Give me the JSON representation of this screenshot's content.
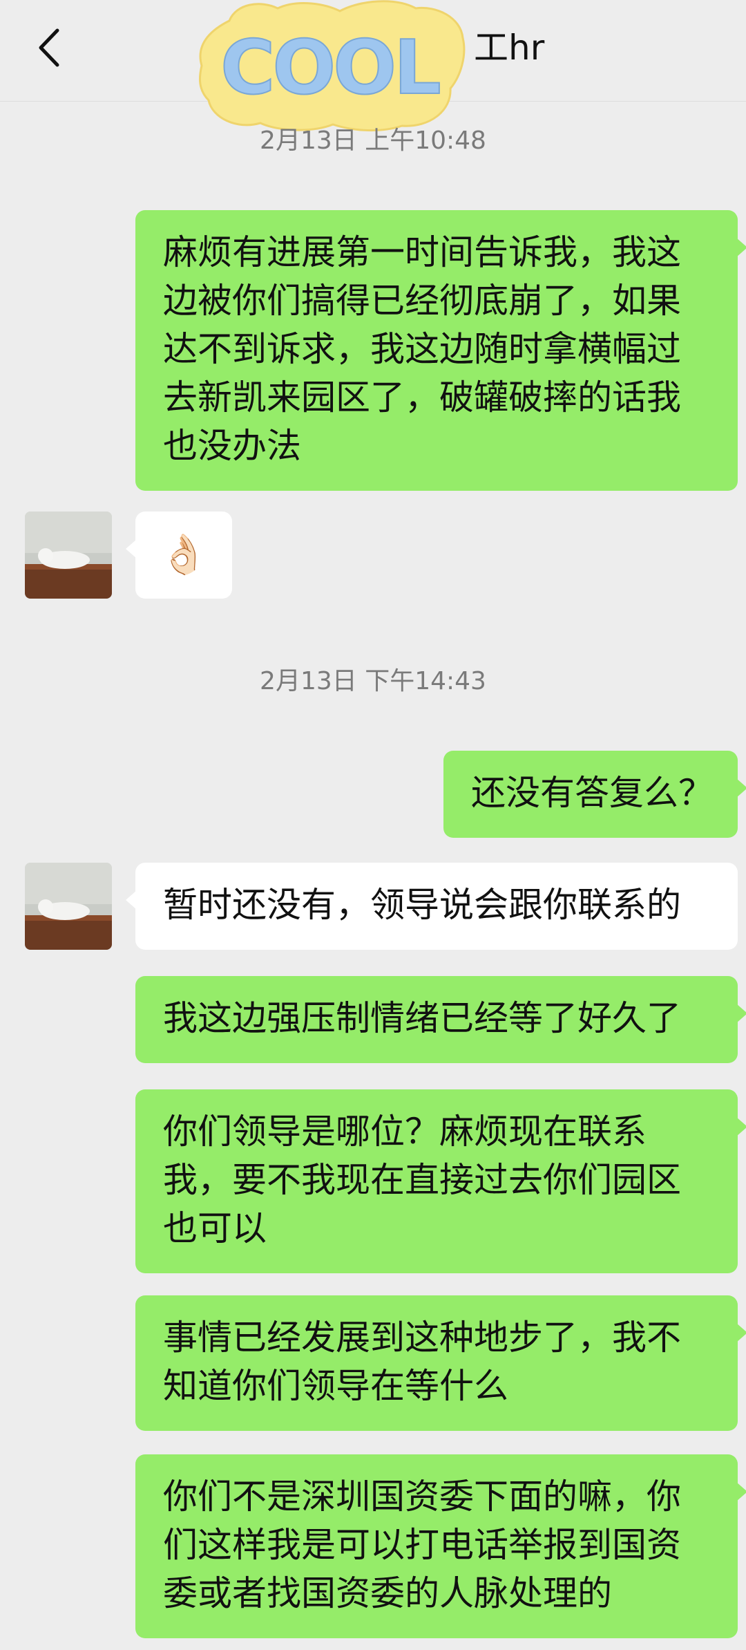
{
  "header": {
    "title": "工hr",
    "sticker_text": "COOL"
  },
  "messages": [
    {
      "type": "time",
      "text": "2月13日 上午10:48"
    },
    {
      "type": "out",
      "lines": [
        "麻烦有进展第一时间告诉我，我这",
        "边被你们搞得已经彻底崩了，如果",
        "达不到诉求，我这边随时拿横幅过",
        "去新凯来园区了，破罐破摔的话我",
        "也没办法"
      ]
    },
    {
      "type": "in",
      "emoji": "👌🏻"
    },
    {
      "type": "time",
      "text": "2月13日 下午14:43"
    },
    {
      "type": "out",
      "lines": [
        "还没有答复么？"
      ]
    },
    {
      "type": "in",
      "lines": [
        "暂时还没有，领导说会跟你联系的"
      ]
    },
    {
      "type": "out",
      "lines": [
        "我这边强压制情绪已经等了好久了"
      ]
    },
    {
      "type": "out",
      "lines": [
        "你们领导是哪位？麻烦现在联系",
        "我，要不我现在直接过去你们园区",
        "也可以"
      ]
    },
    {
      "type": "out",
      "lines": [
        "事情已经发展到这种地步了，我不",
        "知道你们领导在等什么"
      ]
    },
    {
      "type": "out",
      "lines": [
        "你们不是深圳国资委下面的嘛，你",
        "们这样我是可以打电话举报到国资",
        "委或者找国资委的人脉处理的"
      ]
    }
  ],
  "colors": {
    "outgoing": "#95ec69",
    "incoming": "#ffffff",
    "background": "#ededed"
  },
  "icons": {
    "back": "chevron-left-icon",
    "avatar": "cat-photo-avatar",
    "sticker": "cool-sticker"
  }
}
